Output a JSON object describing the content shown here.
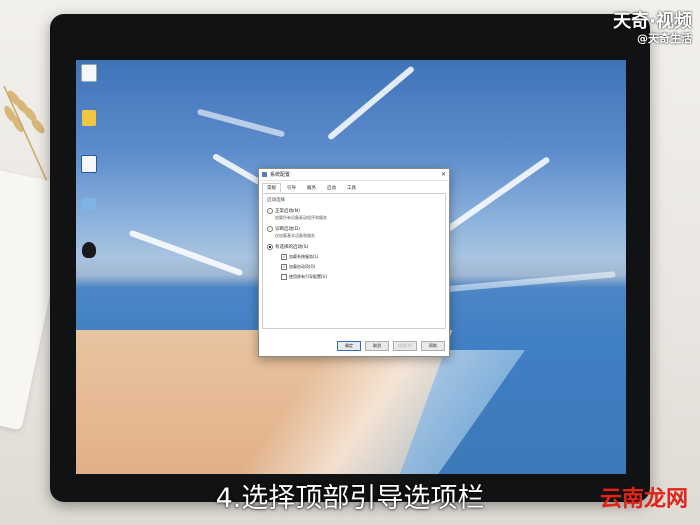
{
  "watermark": {
    "line1": "天奇·视频",
    "line2": "@天奇生活"
  },
  "caption": "4.选择顶部引导选项栏",
  "brand": "云南龙网",
  "desktop_icons": [
    {
      "icon": "document-icon",
      "label": ""
    },
    {
      "icon": "folder-icon",
      "label": ""
    },
    {
      "icon": "word-document-icon",
      "label": ""
    },
    {
      "icon": "computer-icon",
      "label": ""
    },
    {
      "icon": "qq-penguin-icon",
      "label": ""
    }
  ],
  "dialog": {
    "title": "系统配置",
    "close": "✕",
    "tabs": [
      "常规",
      "引导",
      "服务",
      "启动",
      "工具"
    ],
    "group_label": "启动选择",
    "options": [
      {
        "label": "正常启动(N)",
        "sub": "加载所有设备驱动程序和服务",
        "selected": false
      },
      {
        "label": "诊断启动(D)",
        "sub": "仅加载基本设备和服务",
        "selected": false
      },
      {
        "label": "有选择的启动(S)",
        "sub": "",
        "selected": true
      }
    ],
    "checks": [
      {
        "label": "加载系统服务(L)",
        "checked": true
      },
      {
        "label": "加载启动项(O)",
        "checked": true
      },
      {
        "label": "使用原有引导配置(U)",
        "checked": false
      }
    ],
    "buttons": {
      "ok": "确定",
      "cancel": "取消",
      "apply": "应用(A)",
      "help": "帮助"
    }
  },
  "colors": {
    "accent": "#2f6fc0",
    "brand": "#e2231a"
  }
}
